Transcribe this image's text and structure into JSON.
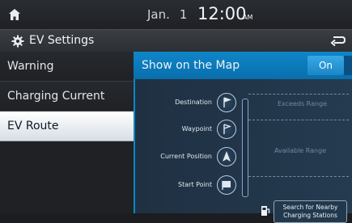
{
  "status": {
    "date_month": "Jan.",
    "date_day": "1",
    "time": "12:00",
    "ampm": "AM"
  },
  "header": {
    "title": "EV Settings"
  },
  "sidebar": {
    "items": [
      {
        "label": "Warning"
      },
      {
        "label": "Charging Current"
      },
      {
        "label": "EV Route"
      }
    ]
  },
  "panel": {
    "title": "Show on the Map",
    "toggle_value": "On",
    "route_points": [
      {
        "label": "Destination"
      },
      {
        "label": "Waypoint"
      },
      {
        "label": "Current Position"
      },
      {
        "label": "Start Point"
      }
    ],
    "range_exceeds": "Exceeds Range",
    "range_available": "Available Range",
    "search_button_line1": "Search for Nearby",
    "search_button_line2": "Charging Stations"
  },
  "colors": {
    "accent": "#0f86c8",
    "active_item_bg": "#ffffff"
  },
  "icons": [
    "home-icon",
    "gear-icon",
    "back-icon",
    "destination-flag-icon",
    "waypoint-flag-icon",
    "current-position-icon",
    "start-point-flag-icon",
    "charging-station-icon"
  ]
}
